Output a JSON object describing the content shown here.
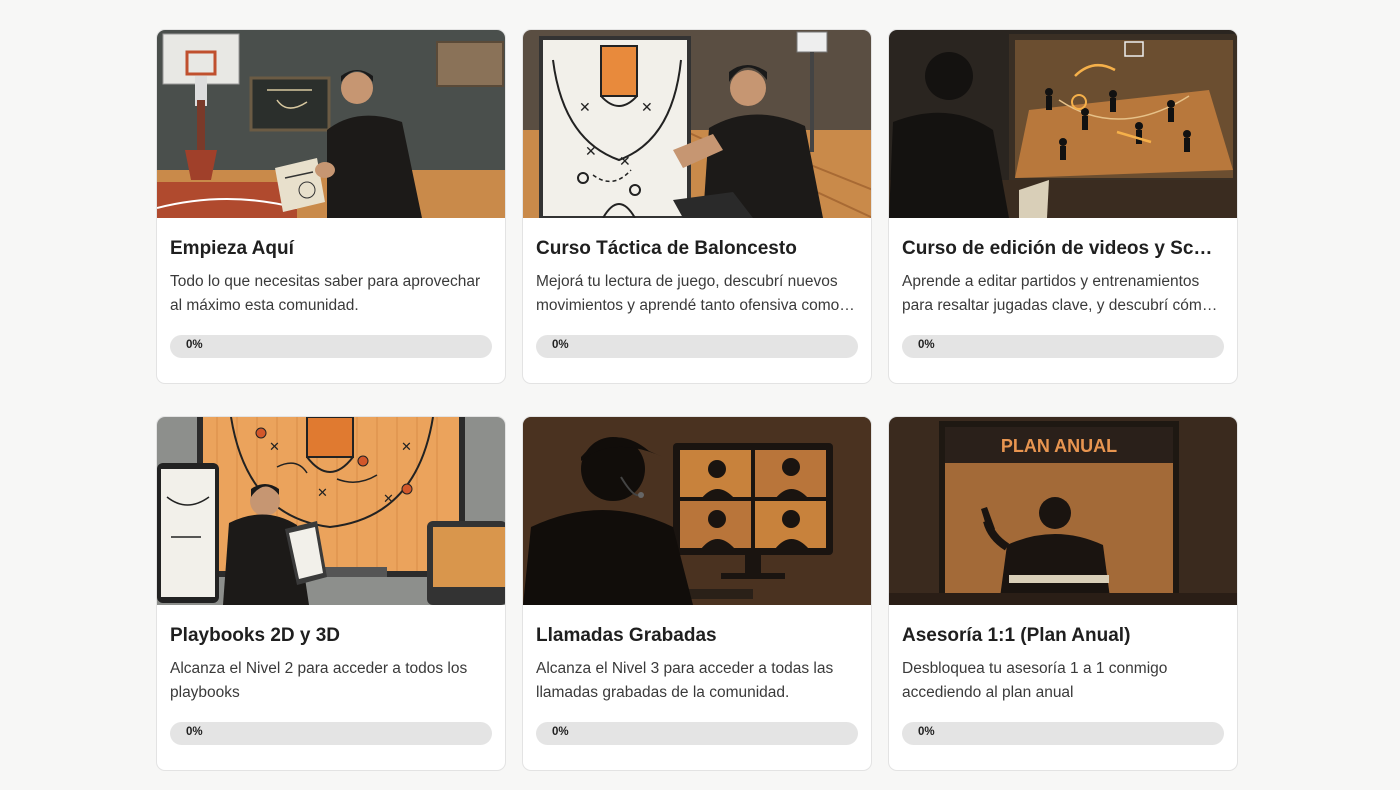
{
  "courses": [
    {
      "title": "Empieza Aquí",
      "description": "Todo lo que necesitas saber para aprovechar al máximo esta comunidad.",
      "progress_label": "0%",
      "progress": 0
    },
    {
      "title": "Curso Táctica de Baloncesto",
      "description": "Mejorá tu lectura de juego, descubrí nuevos movimientos y aprendé tanto ofensiva como defensiva.",
      "progress_label": "0%",
      "progress": 0
    },
    {
      "title": "Curso de edición de videos y Scouting",
      "description": "Aprende a editar partidos y entrenamientos para resaltar jugadas clave, y descubrí cómo hacer scouting.",
      "progress_label": "0%",
      "progress": 0
    },
    {
      "title": "Playbooks 2D y 3D",
      "description": "Alcanza el Nivel 2 para acceder a todos los playbooks",
      "progress_label": "0%",
      "progress": 0
    },
    {
      "title": "Llamadas Grabadas",
      "description": "Alcanza el Nivel 3 para acceder a todas las llamadas grabadas de la comunidad.",
      "progress_label": "0%",
      "progress": 0
    },
    {
      "title": "Asesoría 1:1 (Plan Anual)",
      "description": "Desbloquea tu asesoría 1 a 1 conmigo accediendo al plan anual",
      "progress_label": "0%",
      "progress": 0,
      "thumbnail_text": "PLAN ANUAL"
    }
  ],
  "colors": {
    "accent": "#f5a25a",
    "court_wood": "#c98a4a",
    "dark_silhouette": "#1c1a18"
  }
}
